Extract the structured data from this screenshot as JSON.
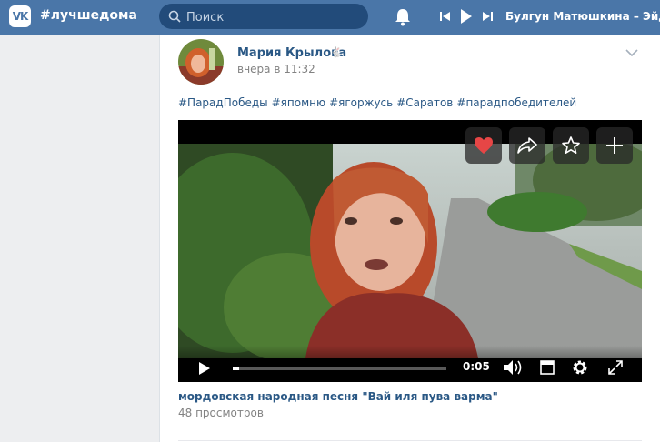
{
  "header": {
    "logo": "VK",
    "hashtag": "#лучшедома",
    "search_placeholder": "Поиск",
    "now_playing": "Булгун Матюшкина – Эйдже"
  },
  "post": {
    "author": "Мария Крылова",
    "time": "вчера в 11:32",
    "hashtags": [
      "#ПарадПобеды",
      "#япомню",
      "#ягоржусь",
      "#Саратов",
      "#парадпобедителей"
    ],
    "video": {
      "time": "0:05",
      "progress": 0.03
    },
    "video_title": "мордовская народная песня \"Вай иля пува варма\"",
    "views": "48 просмотров"
  },
  "colors": {
    "topbar": "#4a76a8",
    "link": "#2a5885",
    "like": "#e64646"
  }
}
